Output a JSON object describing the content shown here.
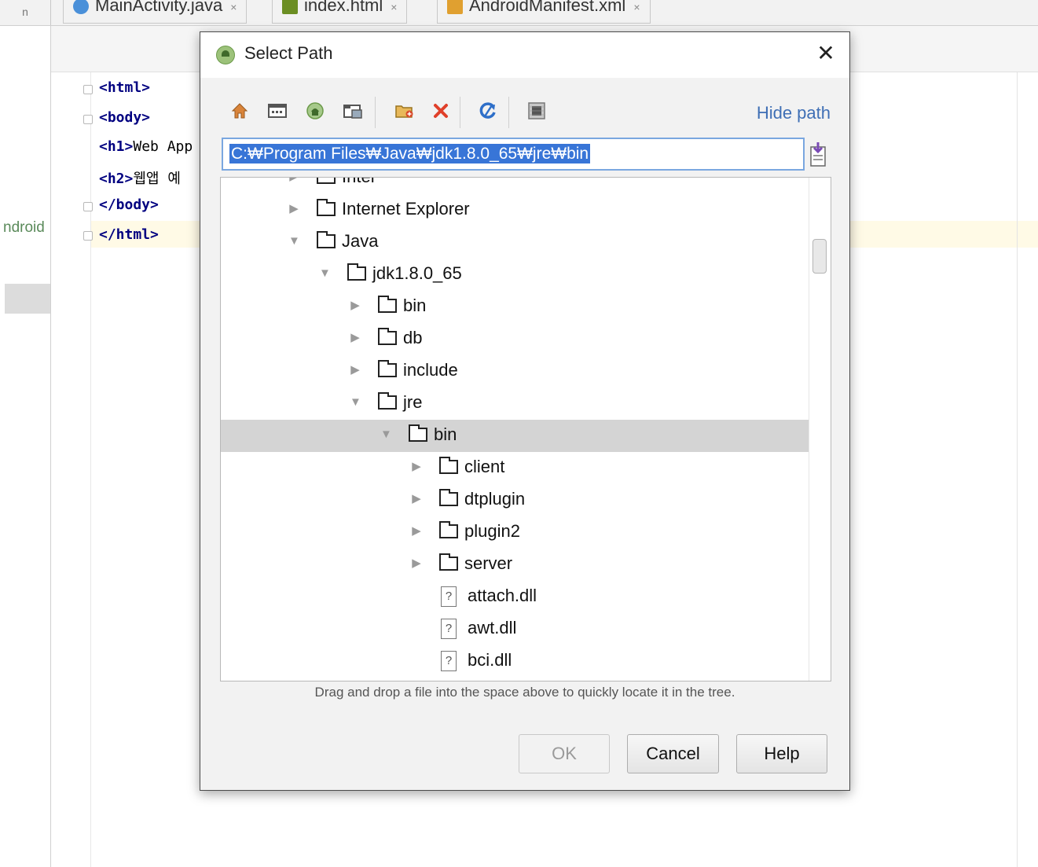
{
  "ide": {
    "tabs": [
      {
        "label": "MainActivity.java",
        "close": "×",
        "icon_color": "#4a90d9"
      },
      {
        "label": "index.html",
        "close": "×",
        "icon_color": "#6b8e23"
      },
      {
        "label": "AndroidManifest.xml",
        "close": "×",
        "icon_color": "#e0a030"
      }
    ],
    "corner_label": "n",
    "project_label": "ndroid",
    "code_lines": [
      {
        "tag": "<html>",
        "rest": ""
      },
      {
        "tag": "<body>",
        "rest": ""
      },
      {
        "tag": "<h1>",
        "rest": "Web App"
      },
      {
        "tag": "<h2>",
        "rest": "웹앱 예"
      },
      {
        "tag": "</body>",
        "rest": ""
      },
      {
        "tag": "</html>",
        "rest": ""
      }
    ]
  },
  "dialog": {
    "title": "Select Path",
    "close_label": "✕",
    "hide_path": "Hide path",
    "path_value": "C:₩Program Files₩Java₩jdk1.8.0_65₩jre₩bin",
    "toolbar": [
      "home-icon",
      "desktop-icon",
      "project-icon",
      "module-icon",
      "new-folder-icon",
      "delete-icon",
      "refresh-icon",
      "show-hidden-icon"
    ],
    "tree": [
      {
        "label": "Intel",
        "type": "folder",
        "depth": 0,
        "state": "collapsed"
      },
      {
        "label": "Internet Explorer",
        "type": "folder",
        "depth": 0,
        "state": "collapsed"
      },
      {
        "label": "Java",
        "type": "folder",
        "depth": 0,
        "state": "expanded"
      },
      {
        "label": "jdk1.8.0_65",
        "type": "folder",
        "depth": 1,
        "state": "expanded"
      },
      {
        "label": "bin",
        "type": "folder",
        "depth": 2,
        "state": "collapsed"
      },
      {
        "label": "db",
        "type": "folder",
        "depth": 2,
        "state": "collapsed"
      },
      {
        "label": "include",
        "type": "folder",
        "depth": 2,
        "state": "collapsed"
      },
      {
        "label": "jre",
        "type": "folder",
        "depth": 2,
        "state": "expanded"
      },
      {
        "label": "bin",
        "type": "folder",
        "depth": 3,
        "state": "expanded",
        "selected": true
      },
      {
        "label": "client",
        "type": "folder",
        "depth": 4,
        "state": "collapsed"
      },
      {
        "label": "dtplugin",
        "type": "folder",
        "depth": 4,
        "state": "collapsed"
      },
      {
        "label": "plugin2",
        "type": "folder",
        "depth": 4,
        "state": "collapsed"
      },
      {
        "label": "server",
        "type": "folder",
        "depth": 4,
        "state": "collapsed"
      },
      {
        "label": "attach.dll",
        "type": "file",
        "depth": 4
      },
      {
        "label": "awt.dll",
        "type": "file",
        "depth": 4
      },
      {
        "label": "bci.dll",
        "type": "file",
        "depth": 4
      }
    ],
    "hint": "Drag and drop a file into the space above to quickly locate it in the tree.",
    "buttons": {
      "ok": "OK",
      "cancel": "Cancel",
      "help": "Help"
    },
    "ok_enabled": false
  }
}
